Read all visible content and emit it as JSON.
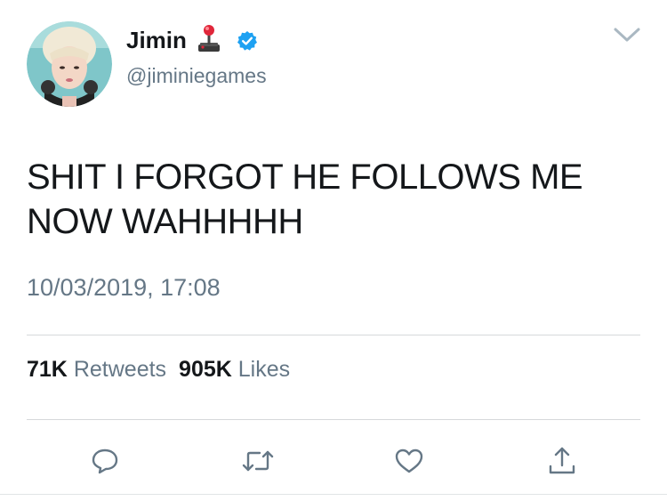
{
  "tweet": {
    "display_name": "Jimin",
    "name_emoji_icon": "joystick-icon",
    "verified_icon": "verified-badge-icon",
    "handle": "@jiminiegames",
    "text": "SHIT I FORGOT HE FOLLOWS ME NOW WAHHHHH",
    "timestamp": "10/03/2019, 17:08",
    "retweets_count": "71K",
    "retweets_label": "Retweets",
    "likes_count": "905K",
    "likes_label": "Likes"
  },
  "actions": {
    "reply_icon": "reply-icon",
    "retweet_icon": "retweet-icon",
    "like_icon": "heart-icon",
    "share_icon": "share-icon"
  },
  "colors": {
    "primary_text": "#14171a",
    "secondary_text": "#657786",
    "verified_blue": "#1da1f2",
    "divider": "#d6d9db",
    "icon_gray": "#657786"
  }
}
